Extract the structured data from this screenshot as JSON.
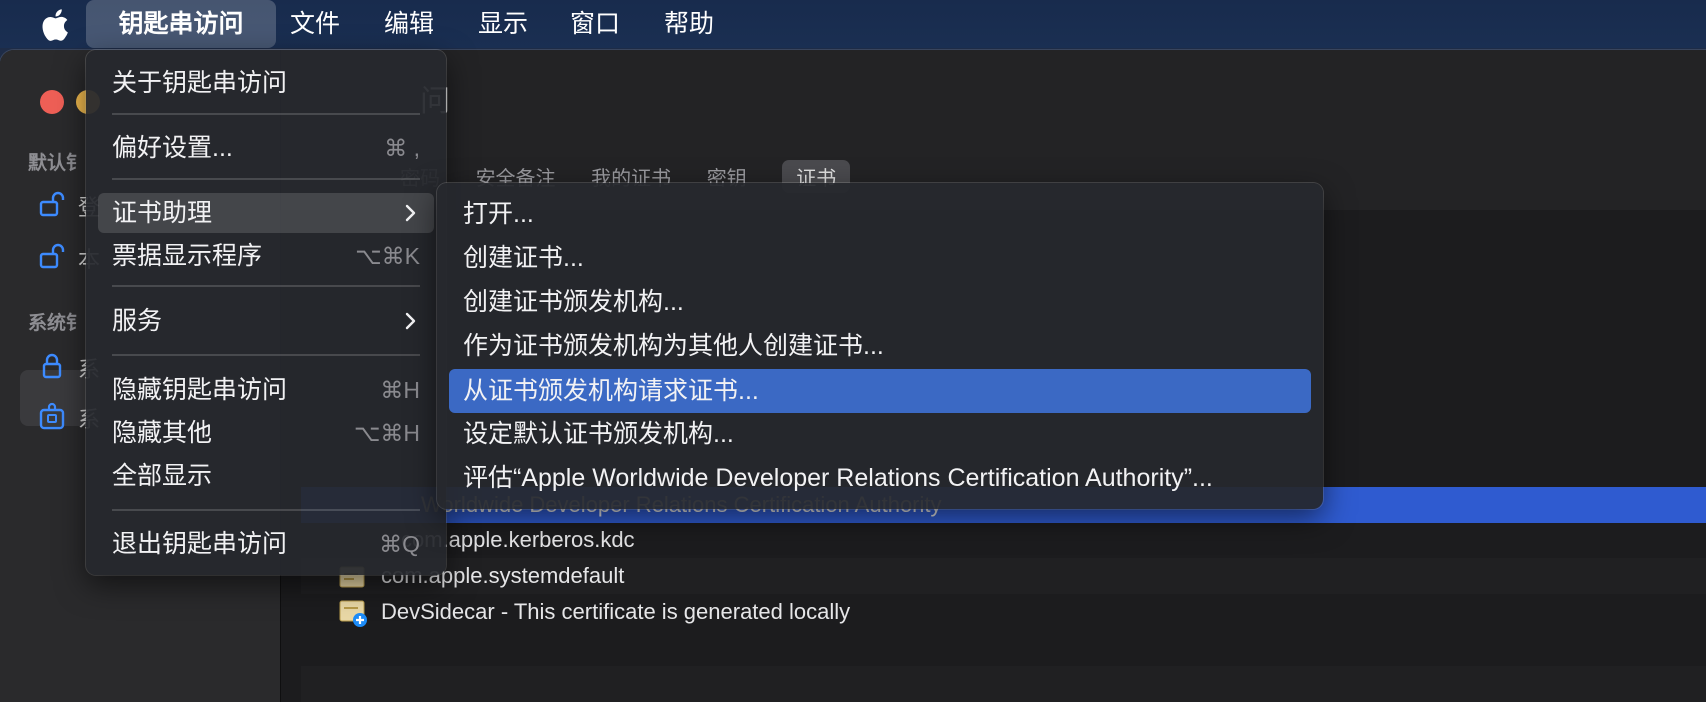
{
  "menubar": {
    "apple_icon": "apple-logo-icon",
    "app_name": "钥匙串访问",
    "items": [
      "文件",
      "编辑",
      "显示",
      "窗口",
      "帮助"
    ]
  },
  "window": {
    "title_fragment": "问",
    "sidebar": {
      "section_default": "默认钅",
      "section_system": "系统钅",
      "default_item_1": "登",
      "default_item_2": "本",
      "system_item_1": "系",
      "system_item_2": "系"
    },
    "tabs": [
      "密码",
      "安全备注",
      "我的证书",
      "密钥",
      "证书"
    ],
    "selected_tab": "证书",
    "rows": [
      {
        "label": "Worldwide Developer Relations Certification Authority",
        "selected": true
      },
      {
        "label": "com.apple.kerberos.kdc",
        "selected": false
      },
      {
        "label": "com.apple.systemdefault",
        "selected": false
      },
      {
        "label": "DevSidecar - This certificate is generated locally",
        "selected": false
      }
    ]
  },
  "app_menu": {
    "about": "关于钥匙串访问",
    "preferences": {
      "label": "偏好设置...",
      "shortcut": "⌘ ,"
    },
    "certificate_assistant": "证书助理",
    "ticket_viewer": {
      "label": "票据显示程序",
      "shortcut": "⌥⌘K"
    },
    "services": "服务",
    "hide_app": {
      "label": "隐藏钥匙串访问",
      "shortcut": "⌘H"
    },
    "hide_others": {
      "label": "隐藏其他",
      "shortcut": "⌥⌘H"
    },
    "show_all": "全部显示",
    "quit": {
      "label": "退出钥匙串访问",
      "shortcut": "⌘Q"
    }
  },
  "cert_submenu": {
    "items": [
      "打开...",
      "创建证书...",
      "创建证书颁发机构...",
      "作为证书颁发机构为其他人创建证书...",
      "从证书颁发机构请求证书...",
      "设定默认证书颁发机构...",
      "评估“Apple Worldwide Developer Relations Certification Authority”..."
    ],
    "highlighted_index": 4
  },
  "colors": {
    "menubar": "#1a2f52",
    "menu_highlight": "#3b69c4",
    "row_selected": "#2f5bd0",
    "traffic_red": "#ee5f56",
    "traffic_yellow": "#f5bd4f"
  }
}
